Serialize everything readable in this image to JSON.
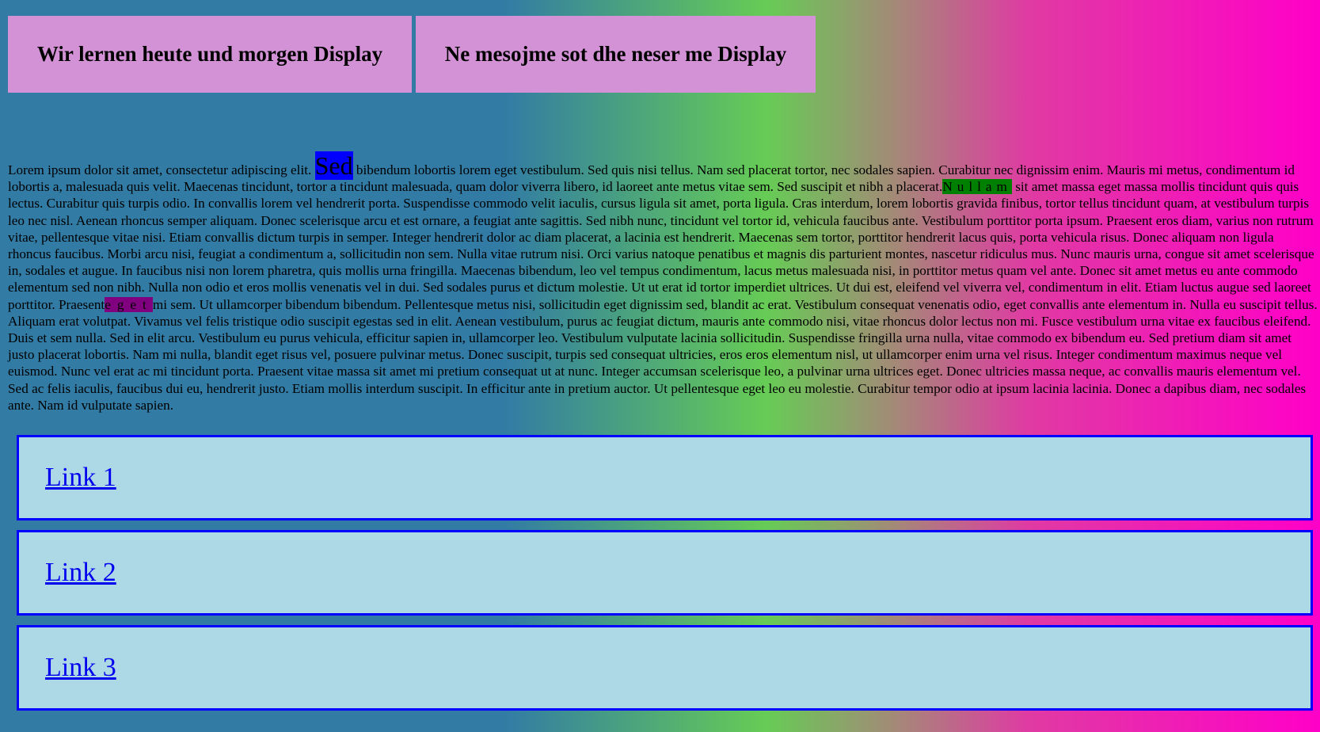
{
  "headings": {
    "box1": "Wir lernen heute und morgen Display",
    "box2": "Ne mesojme sot dhe neser me Display"
  },
  "paragraph": {
    "part1": "Lorem ipsum dolor sit amet, consectetur adipiscing elit. ",
    "sed": "Sed",
    "part2": " bibendum lobortis lorem eget vestibulum. Sed quis nisi tellus. Nam sed placerat tortor, nec sodales sapien. Curabitur nec dignissim enim. Mauris mi metus, condimentum id lobortis a, malesuada quis velit. Maecenas tincidunt, tortor a tincidunt malesuada, quam dolor viverra libero, id laoreet ante metus vitae sem. Sed suscipit et nibh a placerat.",
    "nullam": "Nullam",
    "part3": " sit amet massa eget massa mollis tincidunt quis quis lectus. Curabitur quis turpis odio. In convallis lorem vel hendrerit porta. Suspendisse commodo velit iaculis, cursus ligula sit amet, porta ligula. Cras interdum, lorem lobortis gravida finibus, tortor tellus tincidunt quam, at vestibulum turpis leo nec nisl. Aenean rhoncus semper aliquam. Donec scelerisque arcu et est ornare, a feugiat ante sagittis. Sed nibh nunc, tincidunt vel tortor id, vehicula faucibus ante. Vestibulum porttitor porta ipsum. Praesent eros diam, varius non rutrum vitae, pellentesque vitae nisi. Etiam convallis dictum turpis in semper. Integer hendrerit dolor ac diam placerat, a lacinia est hendrerit. Maecenas sem tortor, porttitor hendrerit lacus quis, porta vehicula risus. Donec aliquam non ligula rhoncus faucibus. Morbi arcu nisi, feugiat a condimentum a, sollicitudin non sem. Nulla vitae rutrum nisi. Orci varius natoque penatibus et magnis dis parturient montes, nascetur ridiculus mus. Nunc mauris urna, congue sit amet scelerisque in, sodales et augue. In faucibus nisi non lorem pharetra, quis mollis urna fringilla. Maecenas bibendum, leo vel tempus condimentum, lacus metus malesuada nisi, in porttitor metus quam vel ante. Donec sit amet metus eu ante commodo elementum sed non nibh. Nulla non odio et eros mollis venenatis vel in dui. Sed sodales purus et dictum molestie. Ut ut erat id tortor imperdiet ultrices. Ut dui est, eleifend vel viverra vel, condimentum in elit. Etiam luctus augue sed laoreet porttitor. Praesent",
    "eget": "eget",
    "part4": "mi sem. Ut ullamcorper bibendum bibendum. Pellentesque metus nisi, sollicitudin eget dignissim sed, blandit ac erat. Vestibulum consequat venenatis odio, eget convallis ante elementum in. Nulla eu suscipit tellus. Aliquam erat volutpat. Vivamus vel felis tristique odio suscipit egestas sed in elit. Aenean vestibulum, purus ac feugiat dictum, mauris ante commodo nisi, vitae rhoncus dolor lectus non mi. Fusce vestibulum urna vitae ex faucibus eleifend. Duis et sem nulla. Sed in elit arcu. Vestibulum eu purus vehicula, efficitur sapien in, ullamcorper leo. Vestibulum vulputate lacinia sollicitudin. Suspendisse fringilla urna nulla, vitae commodo ex bibendum eu. Sed pretium diam sit amet justo placerat lobortis. Nam mi nulla, blandit eget risus vel, posuere pulvinar metus. Donec suscipit, turpis sed consequat ultricies, eros eros elementum nisl, ut ullamcorper enim urna vel risus. Integer condimentum maximus neque vel euismod. Nunc vel erat ac mi tincidunt porta. Praesent vitae massa sit amet mi pretium consequat ut at nunc. Integer accumsan scelerisque leo, a pulvinar urna ultrices eget. Donec ultricies massa neque, ac convallis mauris elementum vel. Sed ac felis iaculis, faucibus dui eu, hendrerit justo. Etiam mollis interdum suscipit. In efficitur ante in pretium auctor. Ut pellentesque eget leo eu molestie. Curabitur tempor odio at ipsum lacinia lacinia. Donec a dapibus diam, nec sodales ante. Nam id vulputate sapien."
  },
  "links": [
    {
      "label": "Link 1"
    },
    {
      "label": "Link 2"
    },
    {
      "label": "Link 3"
    }
  ],
  "colors": {
    "heading_box_bg": "#d492d6",
    "highlight_sed": "#0000ff",
    "highlight_nullam": "#008000",
    "highlight_eget": "#800080",
    "link_box_bg": "#add8e6",
    "link_box_border": "#0000ff"
  }
}
